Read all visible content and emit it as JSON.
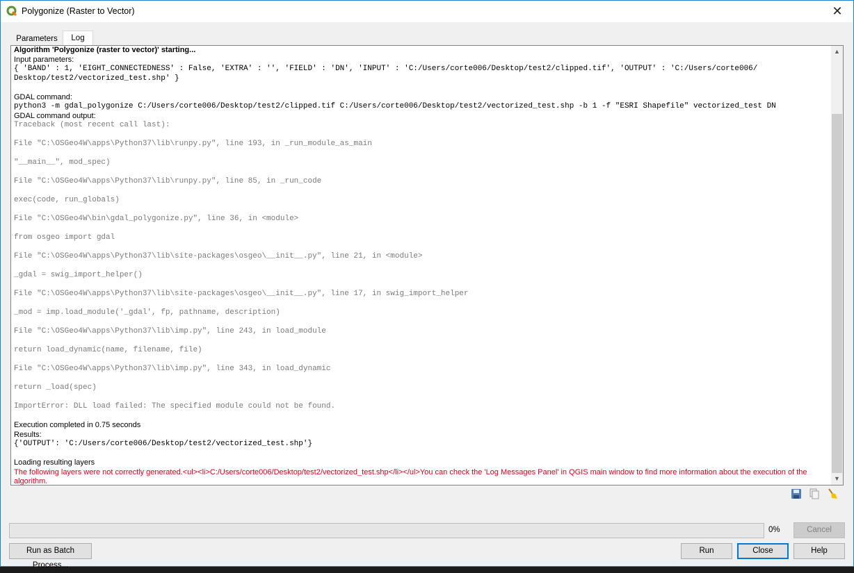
{
  "window": {
    "title": "Polygonize (Raster to Vector)",
    "close_symbol": "✕"
  },
  "tabs": [
    {
      "label": "Parameters",
      "active": false
    },
    {
      "label": "Log",
      "active": true
    }
  ],
  "log": {
    "header": "Algorithm 'Polygonize (raster to vector)' starting...",
    "input_params_label": "Input parameters:",
    "input_params_line1": "{ 'BAND' : 1, 'EIGHT_CONNECTEDNESS' : False, 'EXTRA' : '', 'FIELD' : 'DN', 'INPUT' : 'C:/Users/corte006/Desktop/test2/clipped.tif', 'OUTPUT' : 'C:/Users/corte006/",
    "input_params_line2": "Desktop/test2/vectorized_test.shp' }",
    "gdal_command_label": "GDAL command:",
    "gdal_command": "python3 -m gdal_polygonize C:/Users/corte006/Desktop/test2/clipped.tif C:/Users/corte006/Desktop/test2/vectorized_test.shp -b 1 -f \"ESRI Shapefile\" vectorized_test DN",
    "gdal_output_label": "GDAL command output:",
    "traceback_header": "Traceback (most recent call last):",
    "traceback": [
      "File \"C:\\OSGeo4W\\apps\\Python37\\lib\\runpy.py\", line 193, in _run_module_as_main",
      "\"__main__\", mod_spec)",
      "File \"C:\\OSGeo4W\\apps\\Python37\\lib\\runpy.py\", line 85, in _run_code",
      "exec(code, run_globals)",
      "File \"C:\\OSGeo4W\\bin\\gdal_polygonize.py\", line 36, in <module>",
      "from osgeo import gdal",
      "File \"C:\\OSGeo4W\\apps\\Python37\\lib\\site-packages\\osgeo\\__init__.py\", line 21, in <module>",
      "_gdal = swig_import_helper()",
      "File \"C:\\OSGeo4W\\apps\\Python37\\lib\\site-packages\\osgeo\\__init__.py\", line 17, in swig_import_helper",
      "_mod = imp.load_module('_gdal', fp, pathname, description)",
      "File \"C:\\OSGeo4W\\apps\\Python37\\lib\\imp.py\", line 243, in load_module",
      "return load_dynamic(name, filename, file)",
      "File \"C:\\OSGeo4W\\apps\\Python37\\lib\\imp.py\", line 343, in load_dynamic",
      "return _load(spec)",
      "ImportError: DLL load failed: The specified module could not be found."
    ],
    "execution_time": "Execution completed in 0.75 seconds",
    "results_label": "Results:",
    "results_value": "{'OUTPUT': 'C:/Users/corte006/Desktop/test2/vectorized_test.shp'}",
    "loading_label": "Loading resulting layers",
    "error_message": "The following layers were not correctly generated.<ul><li>C:/Users/corte006/Desktop/test2/vectorized_test.shp</li></ul>You can check the 'Log Messages Panel' in QGIS main window to find more information about the execution of the algorithm."
  },
  "log_tools": {
    "save_icon": "save-log-icon",
    "copy_icon": "copy-log-icon",
    "clear_icon": "clear-log-icon"
  },
  "progress": {
    "value_percent": 0,
    "label": "0%"
  },
  "buttons": {
    "cancel": "Cancel",
    "batch": "Run as Batch Process...",
    "run": "Run",
    "close": "Close",
    "help": "Help"
  },
  "colors": {
    "error_text": "#e0001b",
    "traceback_text": "#7a7a7a",
    "focus_border": "#0078d7",
    "window_border": "#1883d7"
  }
}
